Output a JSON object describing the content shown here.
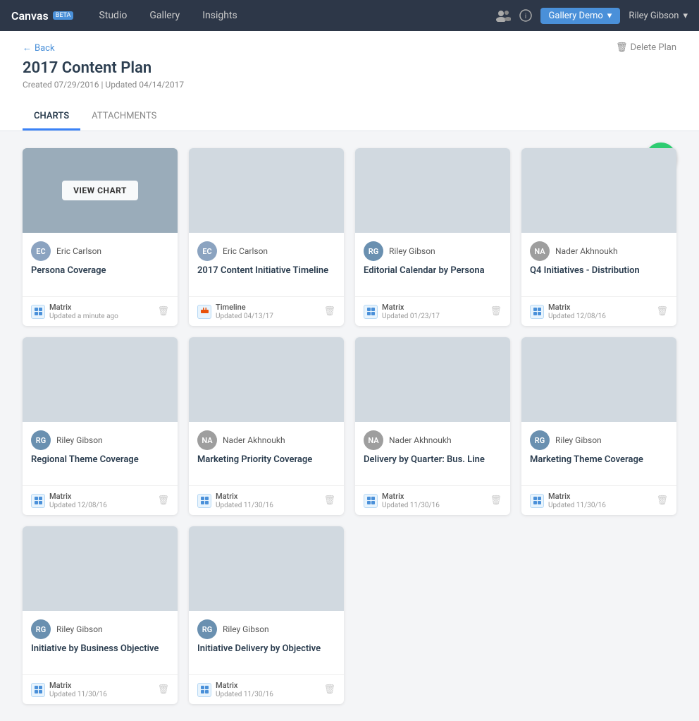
{
  "nav": {
    "logo": "Canvas",
    "beta": "BETA",
    "links": [
      "Studio",
      "Gallery",
      "Insights"
    ],
    "gallery_demo": "Gallery Demo",
    "user": "Riley Gibson",
    "icon_chevron": "▾"
  },
  "header": {
    "back_label": "Back",
    "title": "2017 Content Plan",
    "meta": "Created 07/29/2016  |  Updated 04/14/2017",
    "delete_label": "Delete Plan"
  },
  "tabs": [
    {
      "label": "CHARTS",
      "active": true
    },
    {
      "label": "ATTACHMENTS",
      "active": false
    }
  ],
  "add_button_label": "+",
  "cards": [
    {
      "author": "Eric Carlson",
      "author_initials": "EC",
      "author_type": "eric",
      "title": "Persona Coverage",
      "type": "Matrix",
      "updated": "Updated a minute ago",
      "show_overlay": true
    },
    {
      "author": "Eric Carlson",
      "author_initials": "EC",
      "author_type": "eric",
      "title": "2017 Content Initiative Timeline",
      "type": "Timeline",
      "updated": "Updated 04/13/17",
      "show_overlay": false
    },
    {
      "author": "Riley Gibson",
      "author_initials": "RG",
      "author_type": "riley",
      "title": "Editorial Calendar by Persona",
      "type": "Matrix",
      "updated": "Updated 01/23/17",
      "show_overlay": false
    },
    {
      "author": "Nader Akhnoukh",
      "author_initials": "NA",
      "author_type": "nader",
      "title": "Q4 Initiatives - Distribution",
      "type": "Matrix",
      "updated": "Updated 12/08/16",
      "show_overlay": false
    },
    {
      "author": "Riley Gibson",
      "author_initials": "RG",
      "author_type": "riley",
      "title": "Regional Theme Coverage",
      "type": "Matrix",
      "updated": "Updated 12/08/16",
      "show_overlay": false
    },
    {
      "author": "Nader Akhnoukh",
      "author_initials": "NA",
      "author_type": "nader",
      "title": "Marketing Priority Coverage",
      "type": "Matrix",
      "updated": "Updated 11/30/16",
      "show_overlay": false
    },
    {
      "author": "Nader Akhnoukh",
      "author_initials": "NA",
      "author_type": "nader",
      "title": "Delivery by Quarter: Bus. Line",
      "type": "Matrix",
      "updated": "Updated 11/30/16",
      "show_overlay": false
    },
    {
      "author": "Riley Gibson",
      "author_initials": "RG",
      "author_type": "riley",
      "title": "Marketing Theme Coverage",
      "type": "Matrix",
      "updated": "Updated 11/30/16",
      "show_overlay": false
    },
    {
      "author": "Riley Gibson",
      "author_initials": "RG",
      "author_type": "riley",
      "title": "Initiative by Business Objective",
      "type": "Matrix",
      "updated": "Updated 11/30/16",
      "show_overlay": false
    },
    {
      "author": "Riley Gibson",
      "author_initials": "RG",
      "author_type": "riley",
      "title": "Initiative Delivery by Objective",
      "type": "Matrix",
      "updated": "Updated 11/30/16",
      "show_overlay": false
    }
  ],
  "view_chart_label": "VIEW CHART"
}
